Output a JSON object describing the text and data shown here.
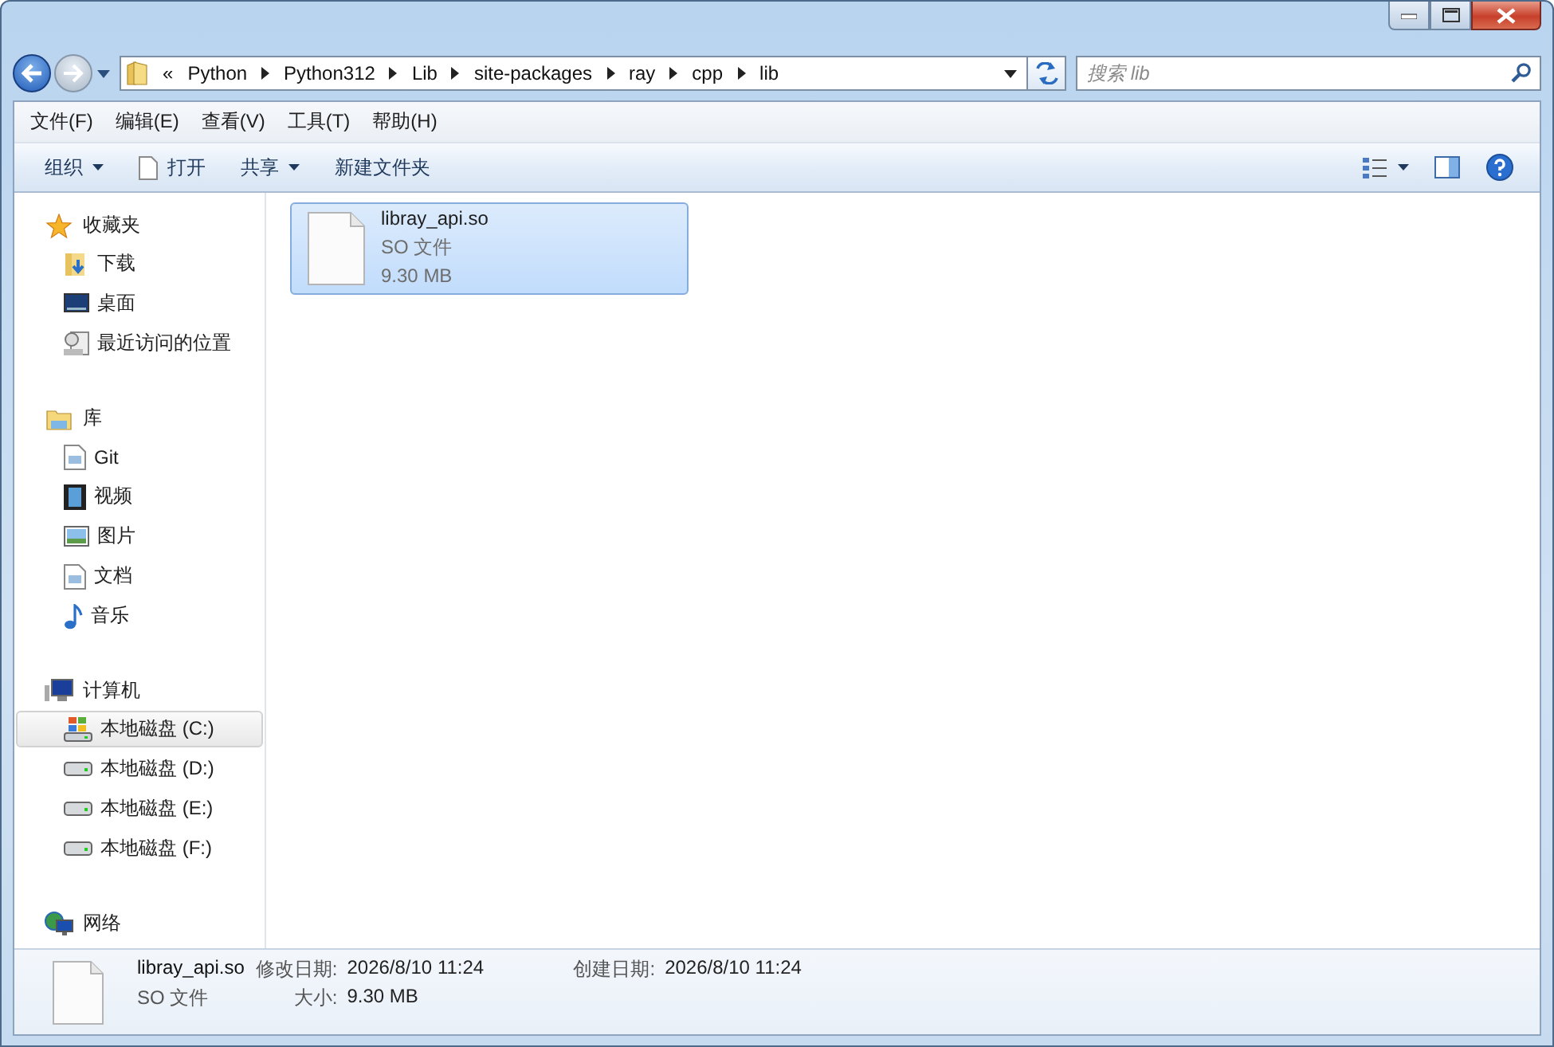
{
  "address": {
    "overflow": "«",
    "segments": [
      "Python",
      "Python312",
      "Lib",
      "site-packages",
      "ray",
      "cpp",
      "lib"
    ]
  },
  "search": {
    "placeholder": "搜索 lib"
  },
  "menu": [
    "文件(F)",
    "编辑(E)",
    "查看(V)",
    "工具(T)",
    "帮助(H)"
  ],
  "commands": [
    {
      "label": "组织",
      "has_menu": true,
      "kind": "plain"
    },
    {
      "label": "打开",
      "has_menu": false,
      "kind": "open"
    },
    {
      "label": "共享",
      "has_menu": true,
      "kind": "plain"
    },
    {
      "label": "新建文件夹",
      "has_menu": false,
      "kind": "plain"
    }
  ],
  "sidebar": {
    "groups": [
      {
        "label": "收藏夹",
        "items": [
          {
            "label": "下载",
            "selected": false
          },
          {
            "label": "桌面",
            "selected": false
          },
          {
            "label": "最近访问的位置",
            "selected": false
          }
        ]
      },
      {
        "label": "库",
        "items": [
          {
            "label": "Git",
            "selected": false
          },
          {
            "label": "视频",
            "selected": false
          },
          {
            "label": "图片",
            "selected": false
          },
          {
            "label": "文档",
            "selected": false
          },
          {
            "label": "音乐",
            "selected": false
          }
        ]
      },
      {
        "label": "计算机",
        "items": [
          {
            "label": "本地磁盘 (C:)",
            "selected": true
          },
          {
            "label": "本地磁盘 (D:)",
            "selected": false
          },
          {
            "label": "本地磁盘 (E:)",
            "selected": false
          },
          {
            "label": "本地磁盘 (F:)",
            "selected": false
          }
        ]
      },
      {
        "label": "网络"
      }
    ]
  },
  "files": [
    {
      "name": "libray_api.so",
      "type": "SO 文件",
      "size": "9.30 MB",
      "selected": true
    }
  ],
  "details": {
    "name": "libray_api.so",
    "type": "SO 文件",
    "properties": [
      {
        "label": "修改日期:",
        "value": "2026/8/10 11:24"
      },
      {
        "label": "大小:",
        "value": "9.30 MB"
      },
      {
        "label": "创建日期:",
        "value": "2026/8/10 11:24"
      }
    ]
  }
}
